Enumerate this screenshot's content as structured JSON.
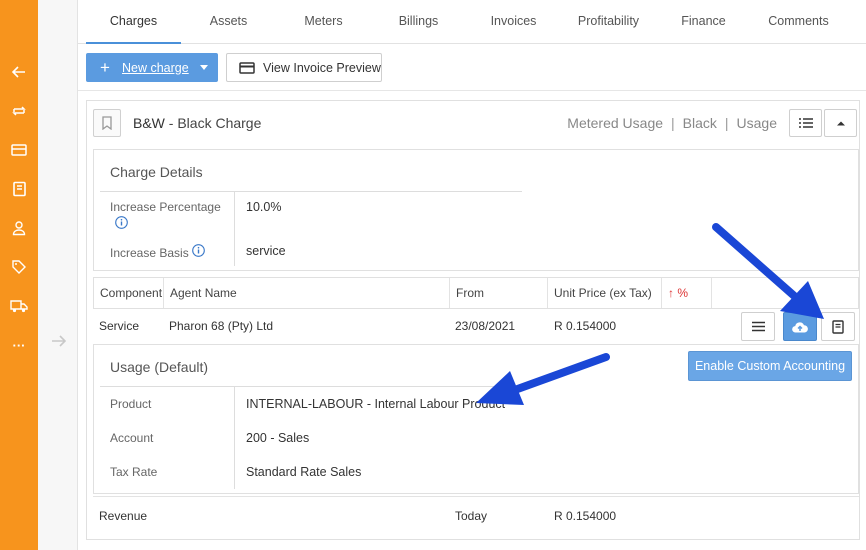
{
  "sidebar": {
    "icons": [
      "back-arrow-icon",
      "repeat-icon",
      "card-icon",
      "book-icon",
      "person-icon",
      "tag-icon",
      "truck-icon",
      "more-icon"
    ]
  },
  "tabs": [
    {
      "label": "Charges",
      "active": true
    },
    {
      "label": "Assets"
    },
    {
      "label": "Meters"
    },
    {
      "label": "Billings"
    },
    {
      "label": "Invoices"
    },
    {
      "label": "Profitability"
    },
    {
      "label": "Finance"
    },
    {
      "label": "Comments"
    }
  ],
  "toolbar": {
    "new_charge": "New charge",
    "view_invoice_preview": "View Invoice Preview"
  },
  "charge": {
    "code": "B&W",
    "name": " - Black Charge",
    "meta": [
      "Metered Usage",
      "Black",
      "Usage"
    ],
    "separator": "|"
  },
  "charge_details": {
    "title": "Charge Details",
    "increase_percentage_label": "Increase Percentage",
    "increase_percentage_value": "10.0%",
    "increase_basis_label": "Increase Basis",
    "increase_basis_value": "service"
  },
  "components": {
    "headers": {
      "component": "Component",
      "agent_name": "Agent Name",
      "from": "From",
      "unit_price": "Unit Price (ex Tax)",
      "percent": "↑ %"
    },
    "row": {
      "component": "Service",
      "agent_name": "Pharon 68 (Pty) Ltd",
      "from": "23/08/2021",
      "unit_price": "R 0.154000"
    }
  },
  "usage": {
    "title": "Usage (Default)",
    "enable_custom": "Enable Custom Accounting",
    "product_label": "Product",
    "product_value": "INTERNAL-LABOUR - Internal Labour Product",
    "account_label": "Account",
    "account_value": "200 - Sales",
    "tax_rate_label": "Tax Rate",
    "tax_rate_value": "Standard Rate Sales"
  },
  "revenue": {
    "label": "Revenue",
    "from": "Today",
    "unit_price": "R 0.154000"
  },
  "colors": {
    "sidebar": "#f7941d",
    "accent": "#5b9be0",
    "annotation_arrow": "#1a47d6"
  }
}
